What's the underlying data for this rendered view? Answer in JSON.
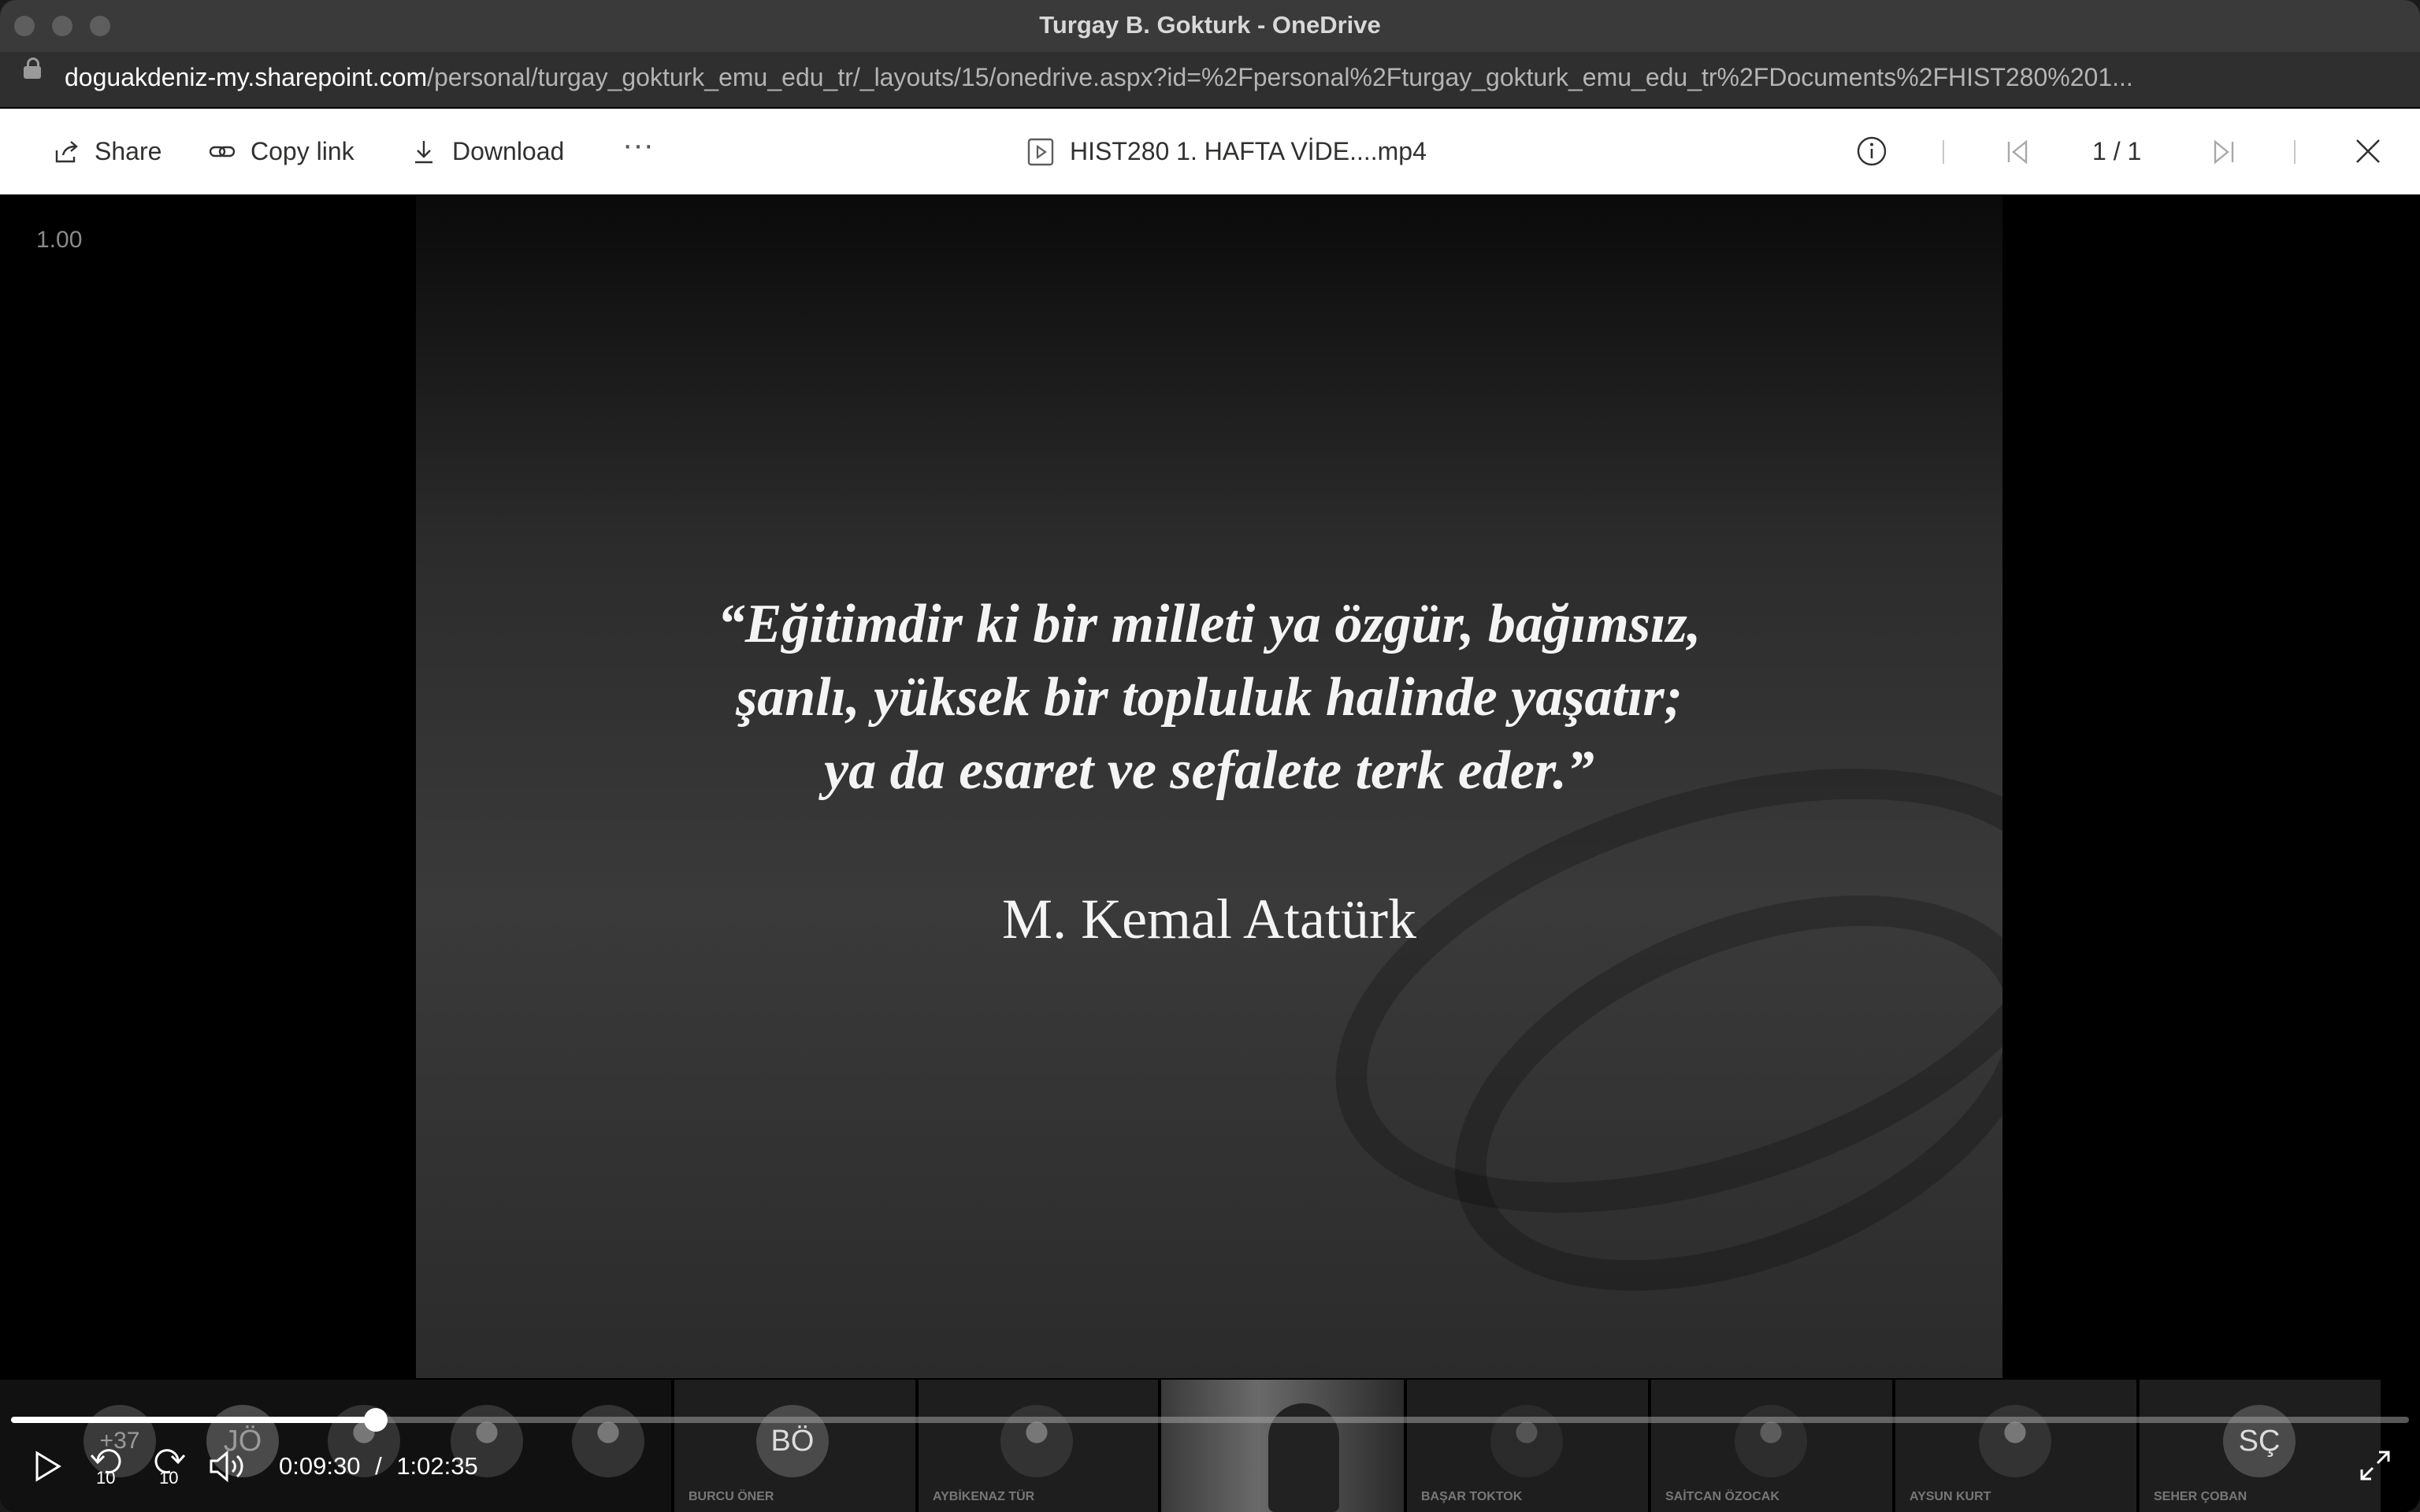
{
  "window": {
    "title": "Turgay B. Gokturk - OneDrive"
  },
  "address": {
    "domain": "doguakdeniz-my.sharepoint.com",
    "path": "/personal/turgay_gokturk_emu_edu_tr/_layouts/15/onedrive.aspx?id=%2Fpersonal%2Fturgay_gokturk_emu_edu_tr%2FDocuments%2FHIST280%201..."
  },
  "toolbar": {
    "share_label": "Share",
    "copy_link_label": "Copy link",
    "download_label": "Download",
    "more_label": "···",
    "file_name": "HIST280 1. HAFTA VİDE....mp4",
    "pager": "1 / 1"
  },
  "player": {
    "playback_rate": "1.00",
    "current_time": "0:09:30",
    "time_separator": "/",
    "duration": "1:02:35",
    "progress_fraction": 0.152,
    "skip_back_seconds": "10",
    "skip_forward_seconds": "10"
  },
  "slide": {
    "quote_lines": [
      "“Eğitimdir ki bir milleti ya özgür, bağımsız,",
      "şanlı, yüksek bir topluluk halinde yaşatır;",
      "ya da esaret ve sefalete terk eder.”"
    ],
    "author": "M. Kemal Atatürk"
  },
  "participants": {
    "overflow_count": "+37",
    "initials": [
      "JÖ",
      "BÖ",
      "SÇ"
    ],
    "names": [
      "BURCU ÖNER",
      "AYBİKENAZ TÜR",
      "BAŞAR TOKTOK",
      "SAİTCAN ÖZOCAK",
      "AYSUN KURT",
      "SEHER ÇOBAN"
    ]
  }
}
